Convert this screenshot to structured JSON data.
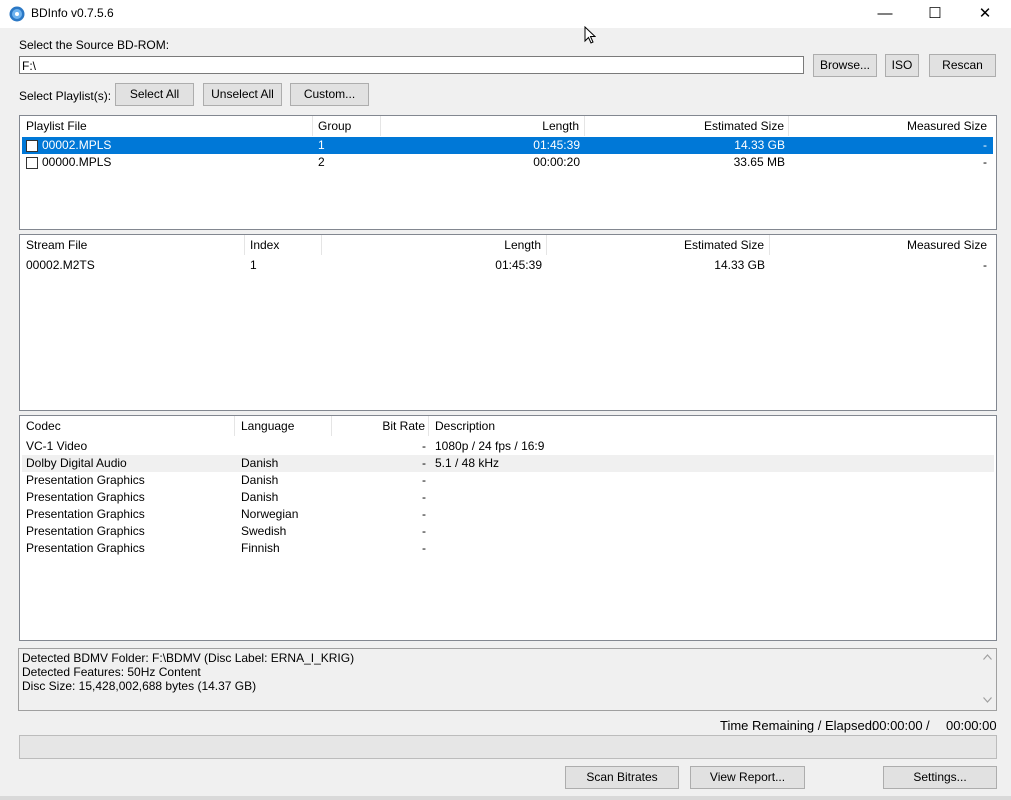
{
  "window": {
    "title": "BDInfo v0.7.5.6",
    "minimize_glyph": "—",
    "maximize_glyph": "☐",
    "close_glyph": "✕"
  },
  "source": {
    "label": "Select the Source BD-ROM:",
    "path": "F:\\",
    "browse_label": "Browse...",
    "iso_label": "ISO",
    "rescan_label": "Rescan"
  },
  "playlist_controls": {
    "label": "Select Playlist(s):",
    "select_all": "Select All",
    "unselect_all": "Unselect All",
    "custom": "Custom..."
  },
  "playlists": {
    "headers": [
      "Playlist File",
      "Group",
      "Length",
      "Estimated Size",
      "Measured Size"
    ],
    "rows": [
      {
        "file": "00002.MPLS",
        "group": "1",
        "length": "01:45:39",
        "estimated": "14.33 GB",
        "measured": "-",
        "selected": true
      },
      {
        "file": "00000.MPLS",
        "group": "2",
        "length": "00:00:20",
        "estimated": "33.65 MB",
        "measured": "-",
        "selected": false
      }
    ]
  },
  "streams": {
    "headers": [
      "Stream File",
      "Index",
      "Length",
      "Estimated Size",
      "Measured Size"
    ],
    "rows": [
      {
        "file": "00002.M2TS",
        "index": "1",
        "length": "01:45:39",
        "estimated": "14.33 GB",
        "measured": "-"
      }
    ]
  },
  "codecs": {
    "headers": [
      "Codec",
      "Language",
      "Bit Rate",
      "Description"
    ],
    "rows": [
      {
        "codec": "VC-1 Video",
        "language": "",
        "bitrate": "-",
        "description": "1080p / 24 fps / 16:9"
      },
      {
        "codec": "Dolby Digital Audio",
        "language": "Danish",
        "bitrate": "-",
        "description": "5.1 / 48 kHz"
      },
      {
        "codec": "Presentation Graphics",
        "language": "Danish",
        "bitrate": "-",
        "description": ""
      },
      {
        "codec": "Presentation Graphics",
        "language": "Danish",
        "bitrate": "-",
        "description": ""
      },
      {
        "codec": "Presentation Graphics",
        "language": "Norwegian",
        "bitrate": "-",
        "description": ""
      },
      {
        "codec": "Presentation Graphics",
        "language": "Swedish",
        "bitrate": "-",
        "description": ""
      },
      {
        "codec": "Presentation Graphics",
        "language": "Finnish",
        "bitrate": "-",
        "description": ""
      }
    ]
  },
  "status": {
    "lines": [
      "Detected BDMV Folder: F:\\BDMV (Disc Label: ERNA_I_KRIG)",
      "Detected Features: 50Hz Content",
      "Disc Size: 15,428,002,688 bytes (14.37 GB)"
    ]
  },
  "timing": {
    "label": "Time Remaining / Elapsed:",
    "remaining": "00:00:00",
    "separator": "/",
    "elapsed": "00:00:00"
  },
  "progress": {
    "fraction": 0
  },
  "bottom_buttons": {
    "scan": "Scan Bitrates",
    "report": "View Report...",
    "settings": "Settings..."
  },
  "colors": {
    "selection": "#0078d7",
    "window_bg": "#f0f0f0",
    "button_bg": "#e1e1e1"
  }
}
